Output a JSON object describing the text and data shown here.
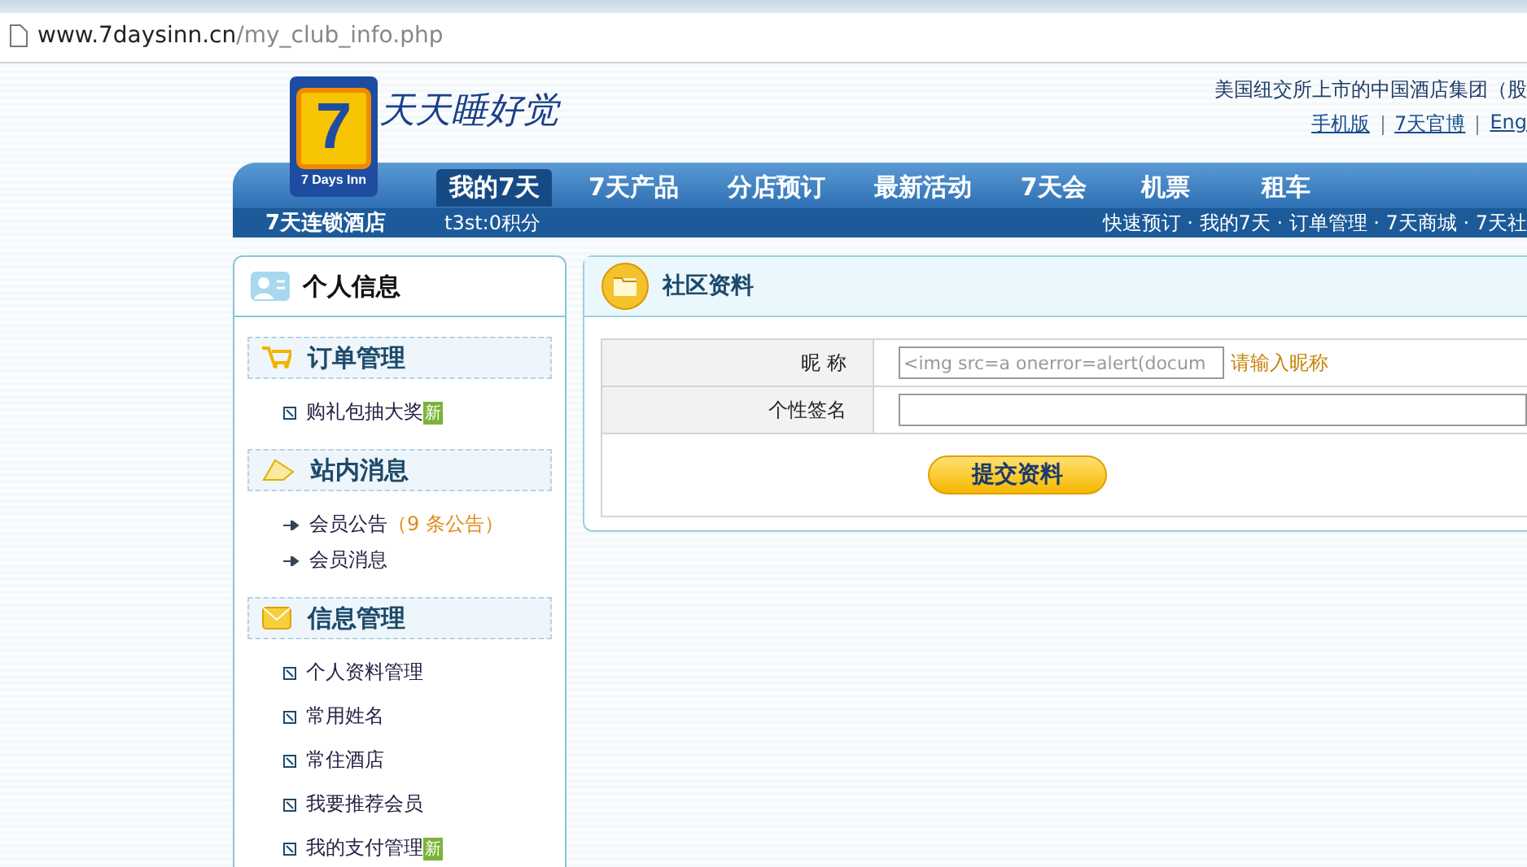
{
  "browser": {
    "url_host": "www.7daysinn.cn",
    "url_path": "/my_club_info.php"
  },
  "header": {
    "logo_numeral": "7",
    "logo_name": "7 Days Inn",
    "slogan": "天天睡好觉",
    "tagline": "美国纽交所上市的中国酒店集团（股",
    "top_links": [
      "手机版",
      "7天官博",
      "Eng"
    ]
  },
  "nav": {
    "items": [
      {
        "label": "我的7天",
        "selected": true
      },
      {
        "label": "7天产品",
        "selected": false
      },
      {
        "label": "分店预订",
        "selected": false
      },
      {
        "label": "最新活动",
        "selected": false
      },
      {
        "label": "7天会",
        "selected": false
      },
      {
        "label": "机票",
        "selected": false
      },
      {
        "label": "租车",
        "selected": false
      }
    ]
  },
  "subbar": {
    "brand": "7天连锁酒店",
    "user": "t3st:0积分",
    "quick_links": "快速预订 · 我的7天 · 订单管理 · 7天商城 · 7天社"
  },
  "sidebar": {
    "title": "个人信息",
    "sections": [
      {
        "title": "订单管理",
        "kind": "cart",
        "items": [
          {
            "label": "购礼包抽大奖",
            "kind": "box",
            "badge": "新"
          }
        ]
      },
      {
        "title": "站内消息",
        "kind": "envelope",
        "items": [
          {
            "label": "会员公告",
            "kind": "arrow",
            "note": "（9 条公告）"
          },
          {
            "label": "会员消息",
            "kind": "arrow"
          }
        ]
      },
      {
        "title": "信息管理",
        "kind": "mail",
        "items": [
          {
            "label": "个人资料管理",
            "kind": "box"
          },
          {
            "label": "常用姓名",
            "kind": "box"
          },
          {
            "label": "常住酒店",
            "kind": "box"
          },
          {
            "label": "我要推荐会员",
            "kind": "box"
          },
          {
            "label": "我的支付管理",
            "kind": "box",
            "badge": "新"
          }
        ]
      }
    ]
  },
  "main": {
    "title": "社区资料",
    "fields": [
      {
        "label": "昵 称",
        "value": "<img src=a onerror=alert(docum",
        "hint": "请输入昵称"
      },
      {
        "label": "个性签名"
      }
    ],
    "submit": "提交资料"
  }
}
